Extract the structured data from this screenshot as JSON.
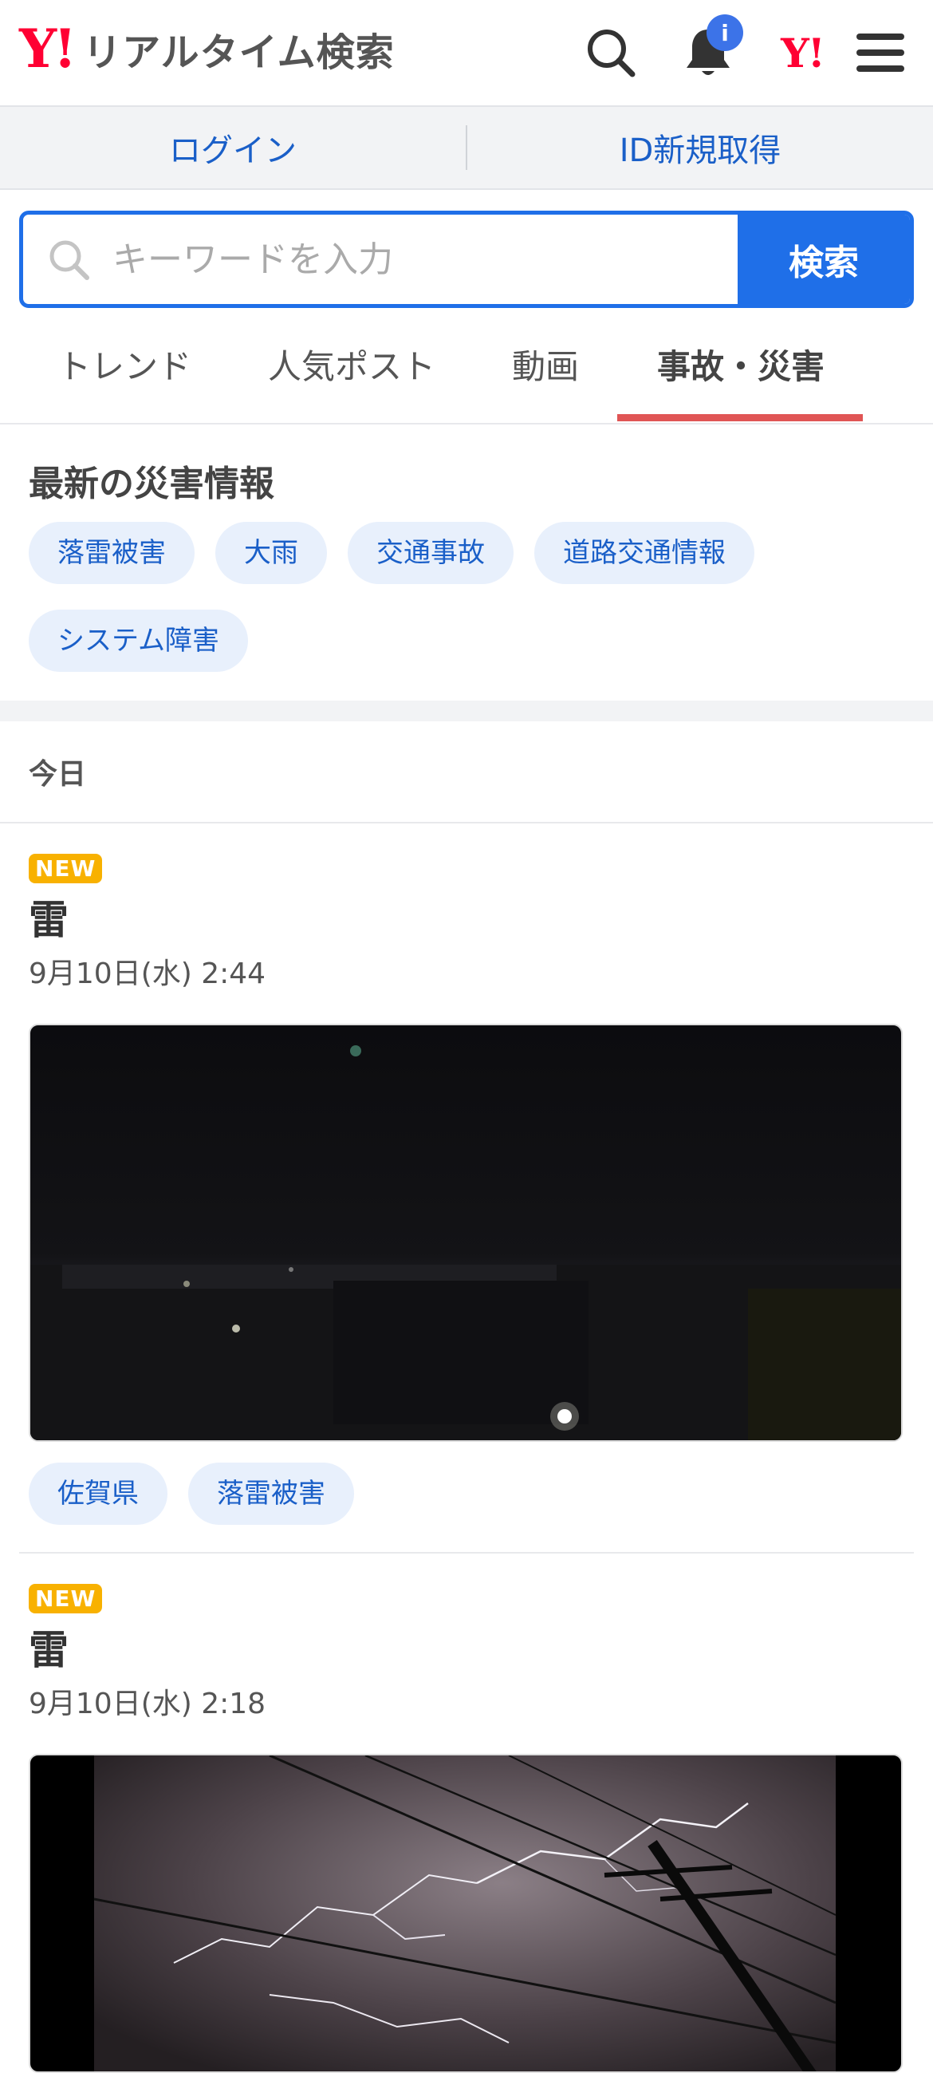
{
  "header": {
    "logo_mark": "Y!",
    "logo_text": "リアルタイム検索",
    "notification_badge": "i",
    "yahoo_mark": "Y!"
  },
  "auth": {
    "login": "ログイン",
    "register": "ID新規取得"
  },
  "search": {
    "placeholder": "キーワードを入力",
    "button": "検索"
  },
  "tabs": [
    {
      "label": "トレンド",
      "active": false
    },
    {
      "label": "人気ポスト",
      "active": false
    },
    {
      "label": "動画",
      "active": false
    },
    {
      "label": "事故・災害",
      "active": true
    }
  ],
  "disaster": {
    "title": "最新の災害情報",
    "chips": [
      "落雷被害",
      "大雨",
      "交通事故",
      "道路交通情報",
      "システム障害"
    ]
  },
  "today_label": "今日",
  "posts": [
    {
      "badge": "NEW",
      "title": "雷",
      "time": "9月10日(水) 2:44",
      "tags": [
        "佐賀県",
        "落雷被害"
      ]
    },
    {
      "badge": "NEW",
      "title": "雷",
      "time": "9月10日(水) 2:18"
    }
  ],
  "colors": {
    "accent": "#1f6fe8",
    "brand": "#ff0033",
    "tab_underline": "#e05555",
    "new_badge": "#f8b100"
  }
}
